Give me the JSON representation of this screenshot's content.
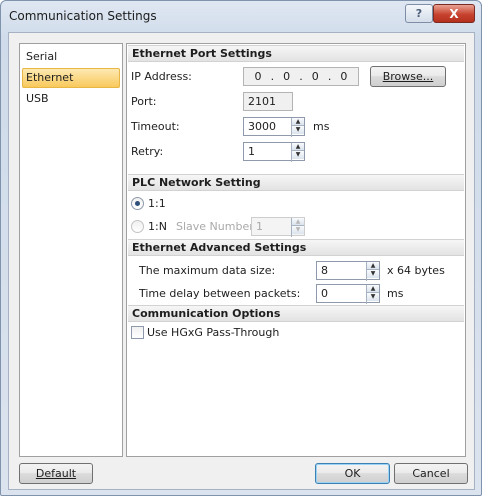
{
  "window": {
    "title": "Communication Settings",
    "help_glyph": "?",
    "close_glyph": "X"
  },
  "sidebar": {
    "items": [
      {
        "label": "Serial",
        "selected": false
      },
      {
        "label": "Ethernet",
        "selected": true
      },
      {
        "label": "USB",
        "selected": false
      }
    ]
  },
  "ethernet_port": {
    "header": "Ethernet Port Settings",
    "ip_label": "IP Address:",
    "ip_octets": [
      "0",
      "0",
      "0",
      "0"
    ],
    "ip_separator": ".",
    "browse_label": "Browse...",
    "port_label": "Port:",
    "port_value": "2101",
    "timeout_label": "Timeout:",
    "timeout_value": "3000",
    "timeout_unit": "ms",
    "retry_label": "Retry:",
    "retry_value": "1"
  },
  "plc_network": {
    "header": "PLC Network Setting",
    "option_1_1": "1:1",
    "option_1_n": "1:N",
    "slave_label": "Slave Number:",
    "slave_value": "1",
    "selected": "1:1"
  },
  "advanced": {
    "header": "Ethernet Advanced Settings",
    "max_data_label": "The maximum data size:",
    "max_data_value": "8",
    "max_data_unit": "x 64 bytes",
    "delay_label": "Time delay between packets:",
    "delay_value": "0",
    "delay_unit": "ms"
  },
  "comm_options": {
    "header": "Communication Options",
    "pass_through_label": "Use HGxG Pass-Through",
    "pass_through_checked": false
  },
  "footer": {
    "default_label": "Default",
    "ok_label": "OK",
    "cancel_label": "Cancel"
  },
  "spinner": {
    "up_glyph": "▲",
    "down_glyph": "▼"
  }
}
